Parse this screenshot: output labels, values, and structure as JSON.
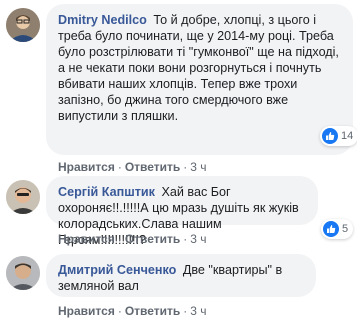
{
  "comments": [
    {
      "author": "Dmitry Nedilco",
      "text": "То й добре, хлопці, з цього і треба було починати, ще у 2014-му році. Треба було розстрілювати ті \"гумконвої\" ще на підході, а не чекати поки вони розгорнуться і почнуть вбивати наших хлопців. Тепер вже трохи запізно, бо джина того смердючого вже випустили з пляшки.",
      "like_label": "Нравится",
      "reply_label": "Ответить",
      "time": "3 ч",
      "reaction_count": "14",
      "reaction_icon": "like-icon"
    },
    {
      "author": "Сергій Капштик",
      "text": "Хай вас Бог охороняє!!.!!!!!А цю мразь душіть як жуків колорадських.Слава нашим Героям!!!!!!!!!!!?",
      "like_label": "Нравится",
      "reply_label": "Ответить",
      "time": "3 ч",
      "reaction_count": "5",
      "reaction_icon": "like-icon"
    },
    {
      "author": "Дмитрий Сенченко",
      "text": "Две \"квартиры\" в земляной вал",
      "like_label": "Нравится",
      "reply_label": "Ответить",
      "time": "3 ч"
    }
  ],
  "colors": {
    "author": "#385898",
    "bubble": "#f2f3f5",
    "like": "#1877f2",
    "meta": "#606770"
  }
}
